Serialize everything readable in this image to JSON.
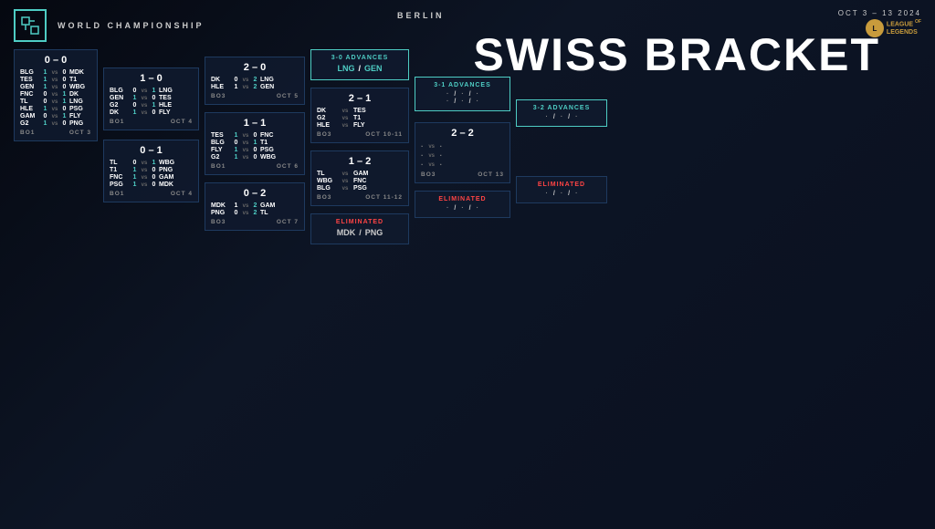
{
  "header": {
    "logo_text": "↗",
    "world_championship": "WORLD CHAMPIONSHIP",
    "berlin": "BERLIN",
    "date_range": "OCT 3 – 13 2024",
    "lol_line1": "LEAGUE",
    "lol_line2": "LEGENDS",
    "swiss_bracket": "SWISS BRACKET"
  },
  "col0": {
    "score": "0 – 0",
    "matches": [
      {
        "t1": "BLG",
        "s1": "1",
        "vs": "vs",
        "s2": "0",
        "t2": "MDK"
      },
      {
        "t1": "TES",
        "s1": "1",
        "vs": "vs",
        "s2": "0",
        "t2": "T1"
      },
      {
        "t1": "GEN",
        "s1": "1",
        "vs": "vs",
        "s2": "0",
        "t2": "WBG"
      },
      {
        "t1": "FNC",
        "s1": "0",
        "vs": "vs",
        "s2": "1",
        "t2": "DK"
      },
      {
        "t1": "TL",
        "s1": "0",
        "vs": "vs",
        "s2": "1",
        "t2": "LNG"
      },
      {
        "t1": "HLE",
        "s1": "1",
        "vs": "vs",
        "s2": "0",
        "t2": "PSG"
      },
      {
        "t1": "GAM",
        "s1": "0",
        "vs": "vs",
        "s2": "1",
        "t2": "FLY"
      },
      {
        "t1": "G2",
        "s1": "1",
        "vs": "vs",
        "s2": "0",
        "t2": "PNG"
      }
    ],
    "footer_format": "BO1",
    "footer_date": "OCT 3"
  },
  "col1": {
    "score_top": "1 – 0",
    "matches_top": [
      {
        "t1": "BLG",
        "s1": "0",
        "vs": "vs",
        "s2": "1",
        "t2": "LNG"
      },
      {
        "t1": "GEN",
        "s1": "1",
        "vs": "vs",
        "s2": "0",
        "t2": "TES"
      },
      {
        "t1": "G2",
        "s1": "0",
        "vs": "vs",
        "s2": "1",
        "t2": "HLE"
      },
      {
        "t1": "DK",
        "s1": "1",
        "vs": "vs",
        "s2": "0",
        "t2": "FLY"
      }
    ],
    "footer_top_format": "BO1",
    "footer_top_date": "OCT 4",
    "score_bot": "0 – 1",
    "matches_bot": [
      {
        "t1": "TL",
        "s1": "0",
        "vs": "vs",
        "s2": "1",
        "t2": "WBG"
      },
      {
        "t1": "T1",
        "s1": "1",
        "vs": "vs",
        "s2": "0",
        "t2": "PNG"
      },
      {
        "t1": "FNC",
        "s1": "1",
        "vs": "vs",
        "s2": "0",
        "t2": "GAM"
      },
      {
        "t1": "PSG",
        "s1": "1",
        "vs": "vs",
        "s2": "0",
        "t2": "MDK"
      }
    ],
    "footer_bot_format": "BO1",
    "footer_bot_date": "OCT 4"
  },
  "col2": {
    "score_top": "2 – 0",
    "matches_top": [
      {
        "t1": "DK",
        "s1": "0",
        "vs": "vs",
        "s2": "2",
        "t2": "LNG"
      },
      {
        "t1": "HLE",
        "s1": "1",
        "vs": "vs",
        "s2": "2",
        "t2": "GEN"
      }
    ],
    "footer_top_format": "BO3",
    "footer_top_date": "OCT 5",
    "score_mid": "1 – 1",
    "matches_mid": [
      {
        "t1": "TES",
        "s1": "1",
        "vs": "vs",
        "s2": "0",
        "t2": "FNC"
      },
      {
        "t1": "BLG",
        "s1": "0",
        "vs": "vs",
        "s2": "1",
        "t2": "T1"
      },
      {
        "t1": "FLY",
        "s1": "1",
        "vs": "vs",
        "s2": "0",
        "t2": "PSG"
      },
      {
        "t1": "G2",
        "s1": "1",
        "vs": "vs",
        "s2": "0",
        "t2": "WBG"
      }
    ],
    "footer_mid_format": "BO1",
    "footer_mid_date": "OCT 6",
    "score_bot": "0 – 2",
    "matches_bot": [
      {
        "t1": "MDK",
        "s1": "1",
        "vs": "vs",
        "s2": "2",
        "t2": "GAM"
      },
      {
        "t1": "PNG",
        "s1": "0",
        "vs": "vs",
        "s2": "2",
        "t2": "TL"
      }
    ],
    "footer_bot_format": "BO3",
    "footer_bot_date": "OCT 7"
  },
  "col3": {
    "advances_label": "3-0 ADVANCES",
    "advances_team1": "LNG",
    "advances_sep": "/",
    "advances_team2": "GEN",
    "score_mid": "2 – 1",
    "matches_mid": [
      {
        "t1": "DK",
        "vs": "vs",
        "t2": "TES"
      },
      {
        "t1": "G2",
        "vs": "vs",
        "t2": "T1"
      },
      {
        "t1": "HLE",
        "vs": "vs",
        "t2": "FLY"
      }
    ],
    "footer_mid_format": "BO3",
    "footer_mid_date": "OCT 10-11",
    "score_bot": "1 – 2",
    "matches_bot": [
      {
        "t1": "TL",
        "vs": "vs",
        "t2": "GAM"
      },
      {
        "t1": "WBG",
        "vs": "vs",
        "t2": "FNC"
      },
      {
        "t1": "BLG",
        "vs": "vs",
        "t2": "PSG"
      }
    ],
    "footer_bot_format": "BO3",
    "footer_bot_date": "OCT 11-12",
    "eliminated_label": "ELIMINATED",
    "eliminated_team1": "MDK",
    "eliminated_sep": "/",
    "eliminated_team2": "PNG"
  },
  "col4": {
    "advances_31_label": "3-1 ADVANCES",
    "tbd_rows_31": [
      ". / . / .",
      ". / . / ."
    ],
    "score_22": "2 – 2",
    "tbd_rows_22": [
      ". vs .",
      ". vs .",
      ". vs ."
    ],
    "footer_22_format": "BO3",
    "footer_22_date": "OCT 13",
    "eliminated_label": "ELIMINATED",
    "tbd_eliminated": ". / . / ."
  },
  "col5": {
    "advances_32_label": "3-2 ADVANCES",
    "tbd_row": ". / . / .",
    "eliminated_label": "ELIMINATED",
    "tbd_elim_row": ". / . / ."
  }
}
